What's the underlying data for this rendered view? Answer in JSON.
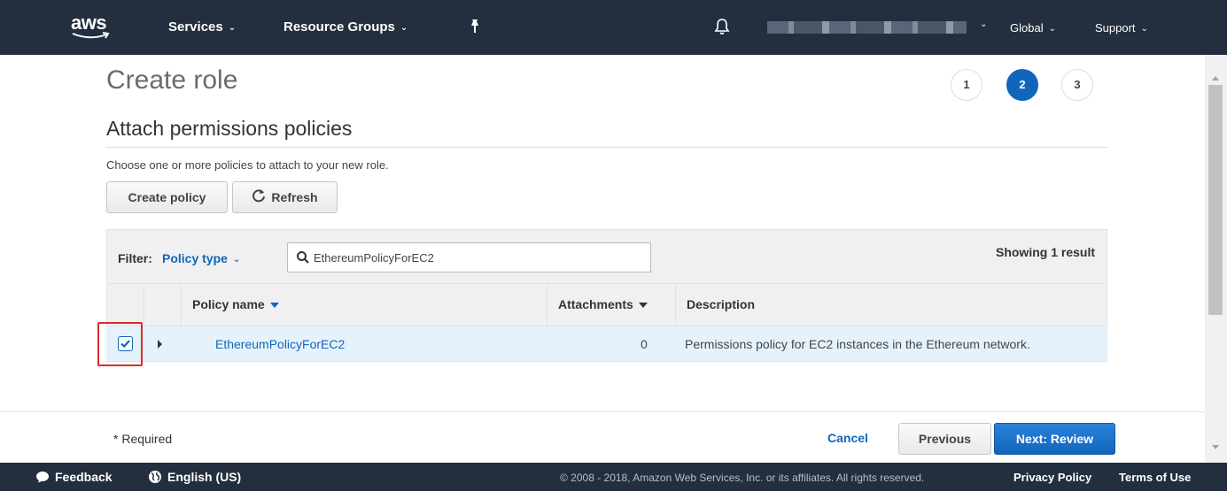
{
  "nav": {
    "logo_text": "aws",
    "services_label": "Services",
    "resource_groups_label": "Resource Groups",
    "global_label": "Global",
    "support_label": "Support"
  },
  "page": {
    "title": "Create role",
    "steps": [
      "1",
      "2",
      "3"
    ],
    "active_step": "2",
    "section_title": "Attach permissions policies",
    "hint": "Choose one or more policies to attach to your new role."
  },
  "toolbar": {
    "create_policy_label": "Create policy",
    "refresh_label": "Refresh"
  },
  "filter": {
    "label": "Filter:",
    "selected": "Policy type",
    "search_value": "EthereumPolicyForEC2",
    "result_count": "Showing 1 result"
  },
  "table": {
    "columns": [
      "Policy name",
      "Attachments",
      "Description"
    ],
    "rows": [
      {
        "checked": true,
        "policy_name": "EthereumPolicyForEC2",
        "attachments": "0",
        "description": "Permissions policy for EC2 instances in the Ethereum network."
      }
    ]
  },
  "footer": {
    "required": "* Required",
    "cancel_label": "Cancel",
    "previous_label": "Previous",
    "next_label": "Next: Review"
  },
  "bottombar": {
    "feedback_label": "Feedback",
    "language_label": "English (US)",
    "copyright": "© 2008 - 2018, Amazon Web Services, Inc. or its affiliates. All rights reserved.",
    "privacy_label": "Privacy Policy",
    "terms_label": "Terms of Use"
  },
  "colors": {
    "nav_bg": "#232f3e",
    "accent_blue": "#1166bb",
    "highlight_red": "#e02b27",
    "selected_row": "#e6f2fb"
  },
  "icons": [
    "aws-logo",
    "chevron-down-icon",
    "pin-icon",
    "bell-icon",
    "refresh-icon",
    "search-icon",
    "checkbox-checked-icon",
    "expand-caret-icon",
    "feedback-icon",
    "globe-icon"
  ]
}
